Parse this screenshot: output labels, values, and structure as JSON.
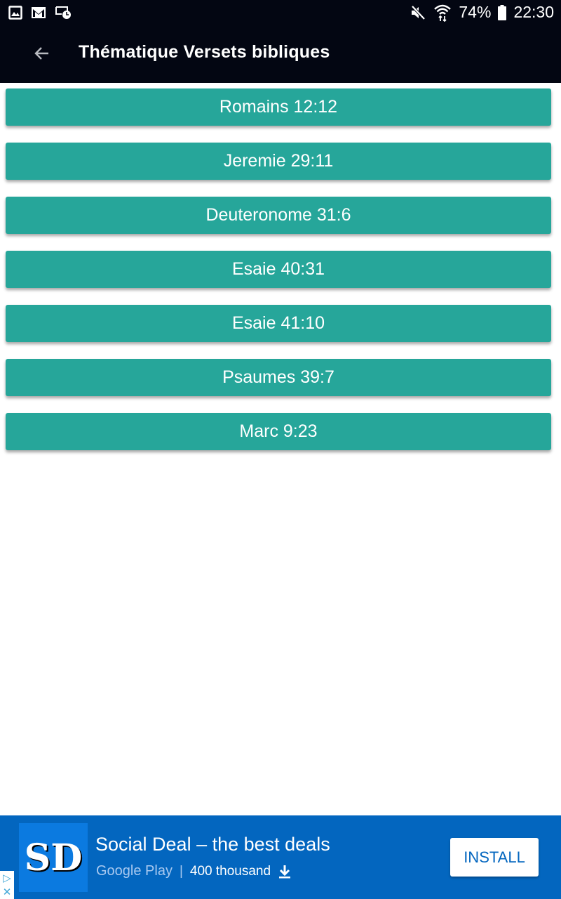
{
  "status_bar": {
    "left_icons": [
      "gallery-icon",
      "gmail-icon",
      "screen-timer-icon"
    ],
    "right_icons": [
      "mute-icon",
      "wifi-icon",
      "battery-icon"
    ],
    "battery": "74%",
    "time": "22:30"
  },
  "app_bar": {
    "back_icon": "arrow-back-icon",
    "title": "Thématique Versets bibliques"
  },
  "verses": [
    {
      "label": "Romains 12:12"
    },
    {
      "label": "Jeremie 29:11"
    },
    {
      "label": "Deuteronome 31:6"
    },
    {
      "label": "Esaie 40:31"
    },
    {
      "label": "Esaie 41:10"
    },
    {
      "label": "Psaumes 39:7"
    },
    {
      "label": "Marc 9:23"
    }
  ],
  "colors": {
    "app_bar": "#030612",
    "verse_button": "#26a69a",
    "ad_background": "#0366bf"
  },
  "ad": {
    "logo_text": "SD",
    "title": "Social Deal – the best deals",
    "store": "Google Play",
    "separator": "|",
    "downloads": "400 thousand",
    "install_label": "INSTALL",
    "adchoices_icon": "▷",
    "close_icon": "✕"
  }
}
